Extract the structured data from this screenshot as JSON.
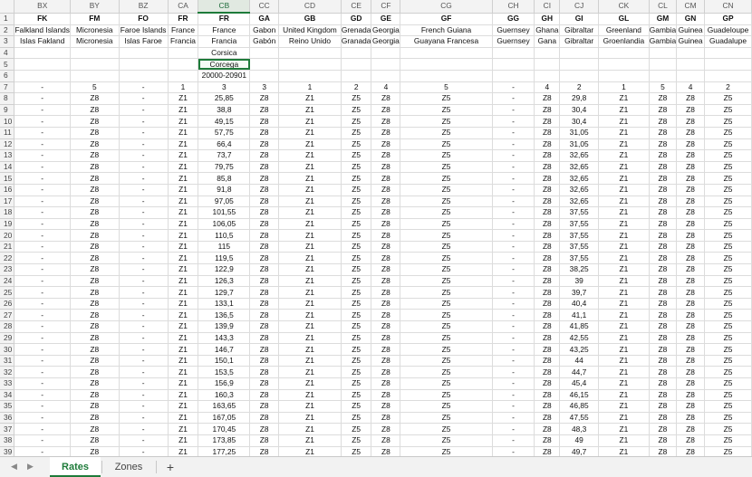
{
  "sheet": {
    "columns": [
      "BX",
      "BY",
      "BZ",
      "CA",
      "CB",
      "CC",
      "CD",
      "CE",
      "CF",
      "CG",
      "CH",
      "CI",
      "CJ",
      "CK",
      "CL",
      "CM",
      "CN"
    ],
    "selected_column": "CB",
    "selected_cell": "CB5",
    "rows": [
      {
        "n": "1",
        "bold": true,
        "c": [
          "FK",
          "FM",
          "FO",
          "FR",
          "FR",
          "GA",
          "GB",
          "GD",
          "GE",
          "GF",
          "GG",
          "GH",
          "GI",
          "GL",
          "GM",
          "GN",
          "GP"
        ]
      },
      {
        "n": "2",
        "c": [
          "Falkland Islands",
          "Micronesia",
          "Faroe Islands",
          "France",
          "France",
          "Gabon",
          "United Kingdom",
          "Grenada",
          "Georgia",
          "French Guiana",
          "Guernsey",
          "Ghana",
          "Gibraltar",
          "Greenland",
          "Gambia",
          "Guinea",
          "Guadeloupe"
        ]
      },
      {
        "n": "3",
        "c": [
          "Islas Fakland",
          "Micronesia",
          "Islas Faroe",
          "Francia",
          "Francia",
          "Gabón",
          "Reino Unido",
          "Granada",
          "Georgia",
          "Guayana Francesa",
          "Guernsey",
          "Gana",
          "Gibraltar",
          "Groenlandia",
          "Gambia",
          "Guinea",
          "Guadalupe"
        ]
      },
      {
        "n": "4",
        "c": [
          "",
          "",
          "",
          "",
          "Corsica",
          "",
          "",
          "",
          "",
          "",
          "",
          "",
          "",
          "",
          "",
          "",
          ""
        ]
      },
      {
        "n": "5",
        "c": [
          "",
          "",
          "",
          "",
          "Corcega",
          "",
          "",
          "",
          "",
          "",
          "",
          "",
          "",
          "",
          "",
          "",
          ""
        ]
      },
      {
        "n": "6",
        "c": [
          "",
          "",
          "",
          "",
          "20000-20901",
          "",
          "",
          "",
          "",
          "",
          "",
          "",
          "",
          "",
          "",
          "",
          ""
        ]
      },
      {
        "n": "7",
        "c": [
          "-",
          "5",
          "-",
          "1",
          "3",
          "3",
          "1",
          "2",
          "4",
          "5",
          "-",
          "4",
          "2",
          "1",
          "5",
          "4",
          "2"
        ]
      },
      {
        "n": "8",
        "c": [
          "-",
          "Z8",
          "-",
          "Z1",
          "25,85",
          "Z8",
          "Z1",
          "Z5",
          "Z8",
          "Z5",
          "-",
          "Z8",
          "29,8",
          "Z1",
          "Z8",
          "Z8",
          "Z5"
        ]
      },
      {
        "n": "9",
        "c": [
          "-",
          "Z8",
          "-",
          "Z1",
          "38,8",
          "Z8",
          "Z1",
          "Z5",
          "Z8",
          "Z5",
          "-",
          "Z8",
          "30,4",
          "Z1",
          "Z8",
          "Z8",
          "Z5"
        ]
      },
      {
        "n": "10",
        "c": [
          "-",
          "Z8",
          "-",
          "Z1",
          "49,15",
          "Z8",
          "Z1",
          "Z5",
          "Z8",
          "Z5",
          "-",
          "Z8",
          "30,4",
          "Z1",
          "Z8",
          "Z8",
          "Z5"
        ]
      },
      {
        "n": "11",
        "c": [
          "-",
          "Z8",
          "-",
          "Z1",
          "57,75",
          "Z8",
          "Z1",
          "Z5",
          "Z8",
          "Z5",
          "-",
          "Z8",
          "31,05",
          "Z1",
          "Z8",
          "Z8",
          "Z5"
        ]
      },
      {
        "n": "12",
        "c": [
          "-",
          "Z8",
          "-",
          "Z1",
          "66,4",
          "Z8",
          "Z1",
          "Z5",
          "Z8",
          "Z5",
          "-",
          "Z8",
          "31,05",
          "Z1",
          "Z8",
          "Z8",
          "Z5"
        ]
      },
      {
        "n": "13",
        "c": [
          "-",
          "Z8",
          "-",
          "Z1",
          "73,7",
          "Z8",
          "Z1",
          "Z5",
          "Z8",
          "Z5",
          "-",
          "Z8",
          "32,65",
          "Z1",
          "Z8",
          "Z8",
          "Z5"
        ]
      },
      {
        "n": "14",
        "c": [
          "-",
          "Z8",
          "-",
          "Z1",
          "79,75",
          "Z8",
          "Z1",
          "Z5",
          "Z8",
          "Z5",
          "-",
          "Z8",
          "32,65",
          "Z1",
          "Z8",
          "Z8",
          "Z5"
        ]
      },
      {
        "n": "15",
        "c": [
          "-",
          "Z8",
          "-",
          "Z1",
          "85,8",
          "Z8",
          "Z1",
          "Z5",
          "Z8",
          "Z5",
          "-",
          "Z8",
          "32,65",
          "Z1",
          "Z8",
          "Z8",
          "Z5"
        ]
      },
      {
        "n": "16",
        "c": [
          "-",
          "Z8",
          "-",
          "Z1",
          "91,8",
          "Z8",
          "Z1",
          "Z5",
          "Z8",
          "Z5",
          "-",
          "Z8",
          "32,65",
          "Z1",
          "Z8",
          "Z8",
          "Z5"
        ]
      },
      {
        "n": "17",
        "c": [
          "-",
          "Z8",
          "-",
          "Z1",
          "97,05",
          "Z8",
          "Z1",
          "Z5",
          "Z8",
          "Z5",
          "-",
          "Z8",
          "32,65",
          "Z1",
          "Z8",
          "Z8",
          "Z5"
        ]
      },
      {
        "n": "18",
        "c": [
          "-",
          "Z8",
          "-",
          "Z1",
          "101,55",
          "Z8",
          "Z1",
          "Z5",
          "Z8",
          "Z5",
          "-",
          "Z8",
          "37,55",
          "Z1",
          "Z8",
          "Z8",
          "Z5"
        ]
      },
      {
        "n": "19",
        "c": [
          "-",
          "Z8",
          "-",
          "Z1",
          "106,05",
          "Z8",
          "Z1",
          "Z5",
          "Z8",
          "Z5",
          "-",
          "Z8",
          "37,55",
          "Z1",
          "Z8",
          "Z8",
          "Z5"
        ]
      },
      {
        "n": "20",
        "c": [
          "-",
          "Z8",
          "-",
          "Z1",
          "110,5",
          "Z8",
          "Z1",
          "Z5",
          "Z8",
          "Z5",
          "-",
          "Z8",
          "37,55",
          "Z1",
          "Z8",
          "Z8",
          "Z5"
        ]
      },
      {
        "n": "21",
        "c": [
          "-",
          "Z8",
          "-",
          "Z1",
          "115",
          "Z8",
          "Z1",
          "Z5",
          "Z8",
          "Z5",
          "-",
          "Z8",
          "37,55",
          "Z1",
          "Z8",
          "Z8",
          "Z5"
        ]
      },
      {
        "n": "22",
        "c": [
          "-",
          "Z8",
          "-",
          "Z1",
          "119,5",
          "Z8",
          "Z1",
          "Z5",
          "Z8",
          "Z5",
          "-",
          "Z8",
          "37,55",
          "Z1",
          "Z8",
          "Z8",
          "Z5"
        ]
      },
      {
        "n": "23",
        "c": [
          "-",
          "Z8",
          "-",
          "Z1",
          "122,9",
          "Z8",
          "Z1",
          "Z5",
          "Z8",
          "Z5",
          "-",
          "Z8",
          "38,25",
          "Z1",
          "Z8",
          "Z8",
          "Z5"
        ]
      },
      {
        "n": "24",
        "c": [
          "-",
          "Z8",
          "-",
          "Z1",
          "126,3",
          "Z8",
          "Z1",
          "Z5",
          "Z8",
          "Z5",
          "-",
          "Z8",
          "39",
          "Z1",
          "Z8",
          "Z8",
          "Z5"
        ]
      },
      {
        "n": "25",
        "c": [
          "-",
          "Z8",
          "-",
          "Z1",
          "129,7",
          "Z8",
          "Z1",
          "Z5",
          "Z8",
          "Z5",
          "-",
          "Z8",
          "39,7",
          "Z1",
          "Z8",
          "Z8",
          "Z5"
        ]
      },
      {
        "n": "26",
        "c": [
          "-",
          "Z8",
          "-",
          "Z1",
          "133,1",
          "Z8",
          "Z1",
          "Z5",
          "Z8",
          "Z5",
          "-",
          "Z8",
          "40,4",
          "Z1",
          "Z8",
          "Z8",
          "Z5"
        ]
      },
      {
        "n": "27",
        "c": [
          "-",
          "Z8",
          "-",
          "Z1",
          "136,5",
          "Z8",
          "Z1",
          "Z5",
          "Z8",
          "Z5",
          "-",
          "Z8",
          "41,1",
          "Z1",
          "Z8",
          "Z8",
          "Z5"
        ]
      },
      {
        "n": "28",
        "c": [
          "-",
          "Z8",
          "-",
          "Z1",
          "139,9",
          "Z8",
          "Z1",
          "Z5",
          "Z8",
          "Z5",
          "-",
          "Z8",
          "41,85",
          "Z1",
          "Z8",
          "Z8",
          "Z5"
        ]
      },
      {
        "n": "29",
        "c": [
          "-",
          "Z8",
          "-",
          "Z1",
          "143,3",
          "Z8",
          "Z1",
          "Z5",
          "Z8",
          "Z5",
          "-",
          "Z8",
          "42,55",
          "Z1",
          "Z8",
          "Z8",
          "Z5"
        ]
      },
      {
        "n": "30",
        "c": [
          "-",
          "Z8",
          "-",
          "Z1",
          "146,7",
          "Z8",
          "Z1",
          "Z5",
          "Z8",
          "Z5",
          "-",
          "Z8",
          "43,25",
          "Z1",
          "Z8",
          "Z8",
          "Z5"
        ]
      },
      {
        "n": "31",
        "c": [
          "-",
          "Z8",
          "-",
          "Z1",
          "150,1",
          "Z8",
          "Z1",
          "Z5",
          "Z8",
          "Z5",
          "-",
          "Z8",
          "44",
          "Z1",
          "Z8",
          "Z8",
          "Z5"
        ]
      },
      {
        "n": "32",
        "c": [
          "-",
          "Z8",
          "-",
          "Z1",
          "153,5",
          "Z8",
          "Z1",
          "Z5",
          "Z8",
          "Z5",
          "-",
          "Z8",
          "44,7",
          "Z1",
          "Z8",
          "Z8",
          "Z5"
        ]
      },
      {
        "n": "33",
        "c": [
          "-",
          "Z8",
          "-",
          "Z1",
          "156,9",
          "Z8",
          "Z1",
          "Z5",
          "Z8",
          "Z5",
          "-",
          "Z8",
          "45,4",
          "Z1",
          "Z8",
          "Z8",
          "Z5"
        ]
      },
      {
        "n": "34",
        "c": [
          "-",
          "Z8",
          "-",
          "Z1",
          "160,3",
          "Z8",
          "Z1",
          "Z5",
          "Z8",
          "Z5",
          "-",
          "Z8",
          "46,15",
          "Z1",
          "Z8",
          "Z8",
          "Z5"
        ]
      },
      {
        "n": "35",
        "c": [
          "-",
          "Z8",
          "-",
          "Z1",
          "163,65",
          "Z8",
          "Z1",
          "Z5",
          "Z8",
          "Z5",
          "-",
          "Z8",
          "46,85",
          "Z1",
          "Z8",
          "Z8",
          "Z5"
        ]
      },
      {
        "n": "36",
        "c": [
          "-",
          "Z8",
          "-",
          "Z1",
          "167,05",
          "Z8",
          "Z1",
          "Z5",
          "Z8",
          "Z5",
          "-",
          "Z8",
          "47,55",
          "Z1",
          "Z8",
          "Z8",
          "Z5"
        ]
      },
      {
        "n": "37",
        "c": [
          "-",
          "Z8",
          "-",
          "Z1",
          "170,45",
          "Z8",
          "Z1",
          "Z5",
          "Z8",
          "Z5",
          "-",
          "Z8",
          "48,3",
          "Z1",
          "Z8",
          "Z8",
          "Z5"
        ]
      },
      {
        "n": "38",
        "c": [
          "-",
          "Z8",
          "-",
          "Z1",
          "173,85",
          "Z8",
          "Z1",
          "Z5",
          "Z8",
          "Z5",
          "-",
          "Z8",
          "49",
          "Z1",
          "Z8",
          "Z8",
          "Z5"
        ]
      },
      {
        "n": "39",
        "c": [
          "-",
          "Z8",
          "-",
          "Z1",
          "177,25",
          "Z8",
          "Z1",
          "Z5",
          "Z8",
          "Z5",
          "-",
          "Z8",
          "49,7",
          "Z1",
          "Z8",
          "Z8",
          "Z5"
        ]
      }
    ]
  },
  "tabs": {
    "items": [
      "Rates",
      "Zones"
    ],
    "active": "Rates",
    "add_label": "+",
    "nav_prev": "◀",
    "nav_next": "▶"
  },
  "colors": {
    "accent": "#1e7b3a",
    "header_bg": "#f3f3f3",
    "gridline": "#dcdcdc"
  }
}
